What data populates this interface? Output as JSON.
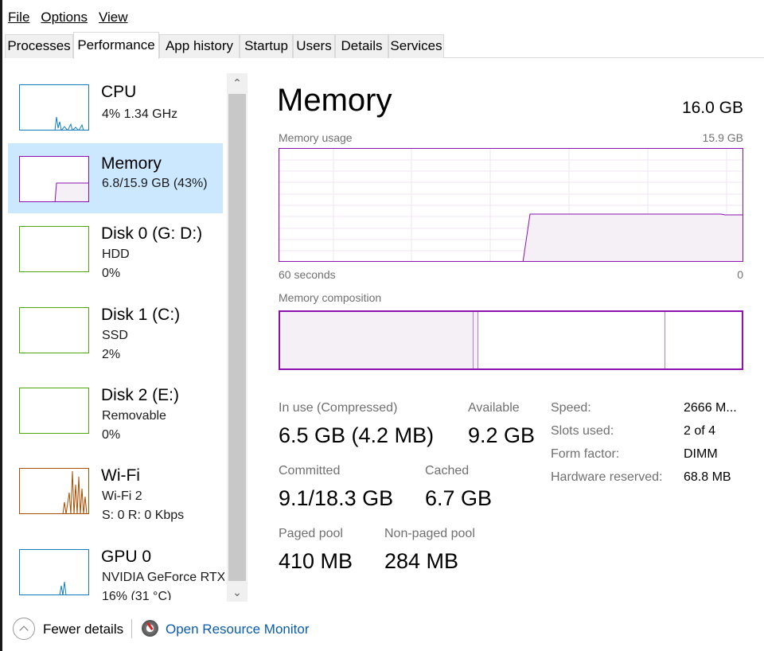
{
  "menu": {
    "file": "File",
    "options": "Options",
    "view": "View"
  },
  "tabs": [
    "Processes",
    "Performance",
    "App history",
    "Startup",
    "Users",
    "Details",
    "Services"
  ],
  "active_tab": "Performance",
  "sidebar": {
    "items": [
      {
        "title": "CPU",
        "line1": "4%  1.34 GHz",
        "line2": "",
        "color": "#117dbb"
      },
      {
        "title": "Memory",
        "line1": "6.8/15.9 GB (43%)",
        "line2": "",
        "color": "#8b12ae"
      },
      {
        "title": "Disk 0 (G: D:)",
        "line1": "HDD",
        "line2": "0%",
        "color": "#4da60c"
      },
      {
        "title": "Disk 1 (C:)",
        "line1": "SSD",
        "line2": "2%",
        "color": "#4da60c"
      },
      {
        "title": "Disk 2 (E:)",
        "line1": "Removable",
        "line2": "0%",
        "color": "#4da60c"
      },
      {
        "title": "Wi-Fi",
        "line1": "Wi-Fi 2",
        "line2": "S: 0  R: 0 Kbps",
        "color": "#a74f01"
      },
      {
        "title": "GPU 0",
        "line1": "NVIDIA GeForce RTX",
        "line2": "16%  (31 °C)",
        "color": "#117dbb"
      }
    ],
    "selected": "Memory"
  },
  "detail": {
    "title": "Memory",
    "total": "16.0 GB",
    "usage_label": "Memory usage",
    "usage_max": "15.9 GB",
    "time_left": "60 seconds",
    "time_right": "0",
    "composition_label": "Memory composition",
    "stats": {
      "in_use_label": "In use (Compressed)",
      "in_use_value": "6.5 GB (4.2 MB)",
      "available_label": "Available",
      "available_value": "9.2 GB",
      "committed_label": "Committed",
      "committed_value": "9.1/18.3 GB",
      "cached_label": "Cached",
      "cached_value": "6.7 GB",
      "paged_label": "Paged pool",
      "paged_value": "410 MB",
      "nonpaged_label": "Non-paged pool",
      "nonpaged_value": "284 MB"
    },
    "kv": [
      {
        "label": "Speed:",
        "value": "2666 M..."
      },
      {
        "label": "Slots used:",
        "value": "2 of 4"
      },
      {
        "label": "Form factor:",
        "value": "DIMM"
      },
      {
        "label": "Hardware reserved:",
        "value": "68.8 MB"
      }
    ],
    "accent_color": "#8b12ae"
  },
  "footer": {
    "fewer_details": "Fewer details",
    "open_resource_monitor": "Open Resource Monitor"
  }
}
